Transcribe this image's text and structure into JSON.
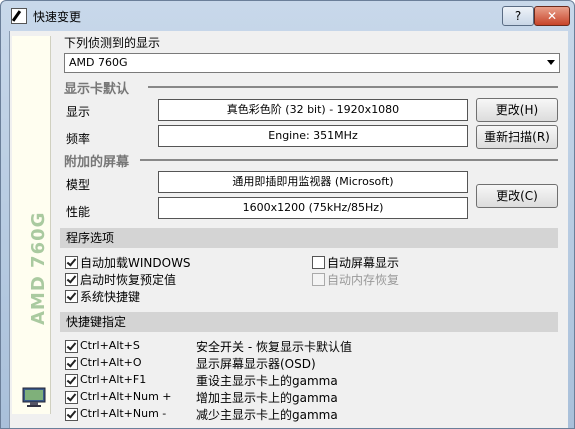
{
  "window": {
    "title": "快速变更",
    "help_label": "?",
    "close_label": "✕"
  },
  "sidebar": {
    "brand_text": "AMD 760G"
  },
  "detected": {
    "label": "下列侦测到的显示",
    "selected": "AMD 760G"
  },
  "adapter": {
    "group_label": "显示卡默认",
    "display_label": "显示",
    "display_value": "真色彩色阶 (32 bit) - 1920x1080",
    "change_label": "更改(H)",
    "freq_label": "频率",
    "freq_value": "Engine: 351MHz",
    "rescan_label": "重新扫描(R)"
  },
  "screen": {
    "group_label": "附加的屏幕",
    "model_label": "模型",
    "model_value": "通用即插即用监视器 (Microsoft)",
    "perf_label": "性能",
    "perf_value": "1600x1200 (75kHz/85Hz)",
    "change_label": "更改(C)"
  },
  "options": {
    "title": "程序选项",
    "items": [
      {
        "label": "自动加载WINDOWS",
        "checked": true,
        "enabled": true
      },
      {
        "label": "启动时恢复预定值",
        "checked": true,
        "enabled": true
      },
      {
        "label": "系统快捷键",
        "checked": true,
        "enabled": true
      },
      {
        "label": "自动屏幕显示",
        "checked": false,
        "enabled": true
      },
      {
        "label": "自动内存恢复",
        "checked": false,
        "enabled": false
      }
    ]
  },
  "hotkeys": {
    "title": "快捷键指定",
    "items": [
      {
        "key": "Ctrl+Alt+S",
        "desc": "安全开关 - 恢复显示卡默认值",
        "checked": true
      },
      {
        "key": "Ctrl+Alt+O",
        "desc": "显示屏幕显示器(OSD)",
        "checked": true
      },
      {
        "key": "Ctrl+Alt+F1",
        "desc": "重设主显示卡上的gamma",
        "checked": true
      },
      {
        "key": "Ctrl+Alt+Num +",
        "desc": "增加主显示卡上的gamma",
        "checked": true
      },
      {
        "key": "Ctrl+Alt+Num -",
        "desc": "减少主显示卡上的gamma",
        "checked": true
      }
    ]
  },
  "icons": [
    "app-icon",
    "monitor-icon",
    "dropdown-arrow-icon"
  ]
}
